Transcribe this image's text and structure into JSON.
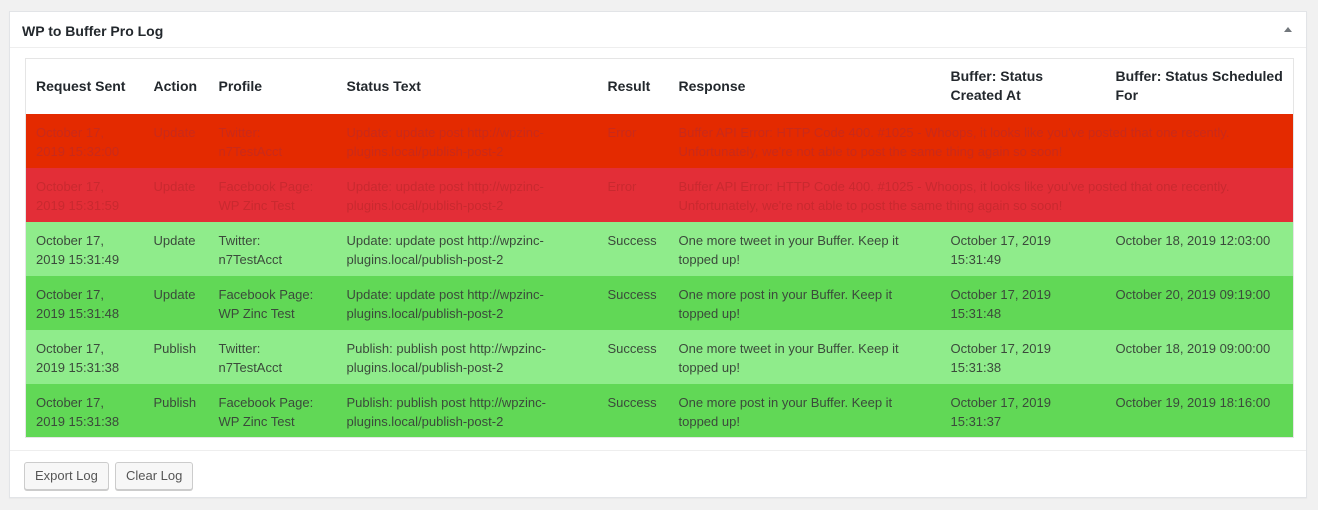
{
  "panel": {
    "title": "WP to Buffer Pro Log"
  },
  "table": {
    "columns": [
      "Request Sent",
      "Action",
      "Profile",
      "Status Text",
      "Result",
      "Response",
      "Buffer: Status Created At",
      "Buffer: Status Scheduled For"
    ],
    "rows": [
      {
        "request_sent": "October 17, 2019 15:32:00",
        "action": "Update",
        "profile": "Twitter: n7TestAcct",
        "status_text": "Update: update post http://wpzinc-plugins.local/publish-post-2",
        "result": "Error",
        "response": "Buffer API Error: HTTP Code 400. #1025 - Whoops, it looks like you've posted that one recently. Unfortunately, we're not able to post the same thing again so soon!",
        "created_at": "",
        "scheduled_for": "",
        "style": "err-a"
      },
      {
        "request_sent": "October 17, 2019 15:31:59",
        "action": "Update",
        "profile": "Facebook Page: WP Zinc Test",
        "status_text": "Update: update post http://wpzinc-plugins.local/publish-post-2",
        "result": "Error",
        "response": "Buffer API Error: HTTP Code 400. #1025 - Whoops, it looks like you've posted that one recently. Unfortunately, we're not able to post the same thing again so soon!",
        "created_at": "",
        "scheduled_for": "",
        "style": "err-b"
      },
      {
        "request_sent": "October 17, 2019 15:31:49",
        "action": "Update",
        "profile": "Twitter: n7TestAcct",
        "status_text": "Update: update post http://wpzinc-plugins.local/publish-post-2",
        "result": "Success",
        "response": "One more tweet in your Buffer. Keep it topped up!",
        "created_at": "October 17, 2019 15:31:49",
        "scheduled_for": "October 18, 2019 12:03:00",
        "style": "ok-a"
      },
      {
        "request_sent": "October 17, 2019 15:31:48",
        "action": "Update",
        "profile": "Facebook Page: WP Zinc Test",
        "status_text": "Update: update post http://wpzinc-plugins.local/publish-post-2",
        "result": "Success",
        "response": "One more post in your Buffer. Keep it topped up!",
        "created_at": "October 17, 2019 15:31:48",
        "scheduled_for": "October 20, 2019 09:19:00",
        "style": "ok-b"
      },
      {
        "request_sent": "October 17, 2019 15:31:38",
        "action": "Publish",
        "profile": "Twitter: n7TestAcct",
        "status_text": "Publish: publish post http://wpzinc-plugins.local/publish-post-2",
        "result": "Success",
        "response": "One more tweet in your Buffer. Keep it topped up!",
        "created_at": "October 17, 2019 15:31:38",
        "scheduled_for": "October 18, 2019 09:00:00",
        "style": "ok-a"
      },
      {
        "request_sent": "October 17, 2019 15:31:38",
        "action": "Publish",
        "profile": "Facebook Page: WP Zinc Test",
        "status_text": "Publish: publish post http://wpzinc-plugins.local/publish-post-2",
        "result": "Success",
        "response": "One more post in your Buffer. Keep it topped up!",
        "created_at": "October 17, 2019 15:31:37",
        "scheduled_for": "October 19, 2019 18:16:00",
        "style": "ok-b"
      }
    ]
  },
  "footer": {
    "export_label": "Export Log",
    "clear_label": "Clear Log"
  },
  "colors": {
    "error_row_a": "#e42a00",
    "error_row_b": "#e32e37",
    "success_row_a": "#8fec8b",
    "success_row_b": "#61d856"
  }
}
